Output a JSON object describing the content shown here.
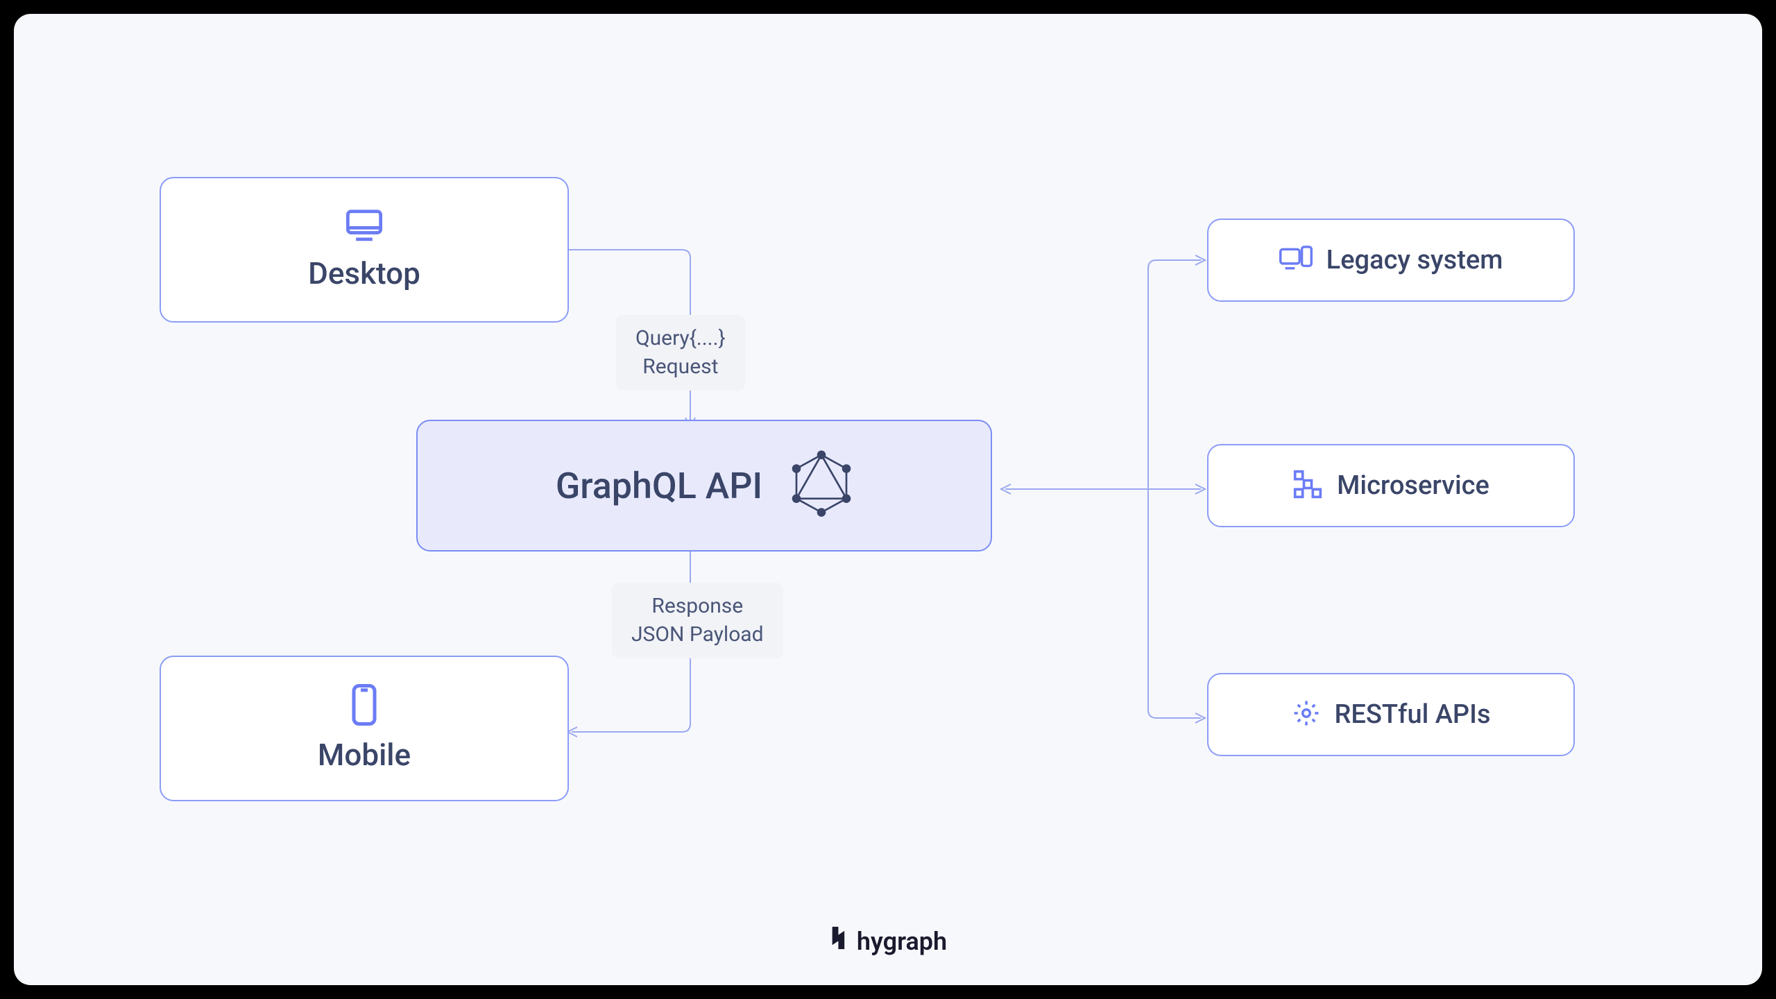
{
  "nodes": {
    "desktop": {
      "label": "Desktop"
    },
    "mobile": {
      "label": "Mobile"
    },
    "center": {
      "label": "GraphQL API"
    },
    "legacy": {
      "label": "Legacy system"
    },
    "microservice": {
      "label": "Microservice"
    },
    "restful": {
      "label": "RESTful APIs"
    }
  },
  "edges": {
    "request": {
      "line1": "Query{....}",
      "line2": "Request"
    },
    "response": {
      "line1": "Response",
      "line2": "JSON Payload"
    }
  },
  "brand": "hygraph",
  "colors": {
    "node_border": "#8b9cf7",
    "center_fill": "#e8eafc",
    "text": "#3a4568",
    "connector": "#9aa8f0"
  }
}
